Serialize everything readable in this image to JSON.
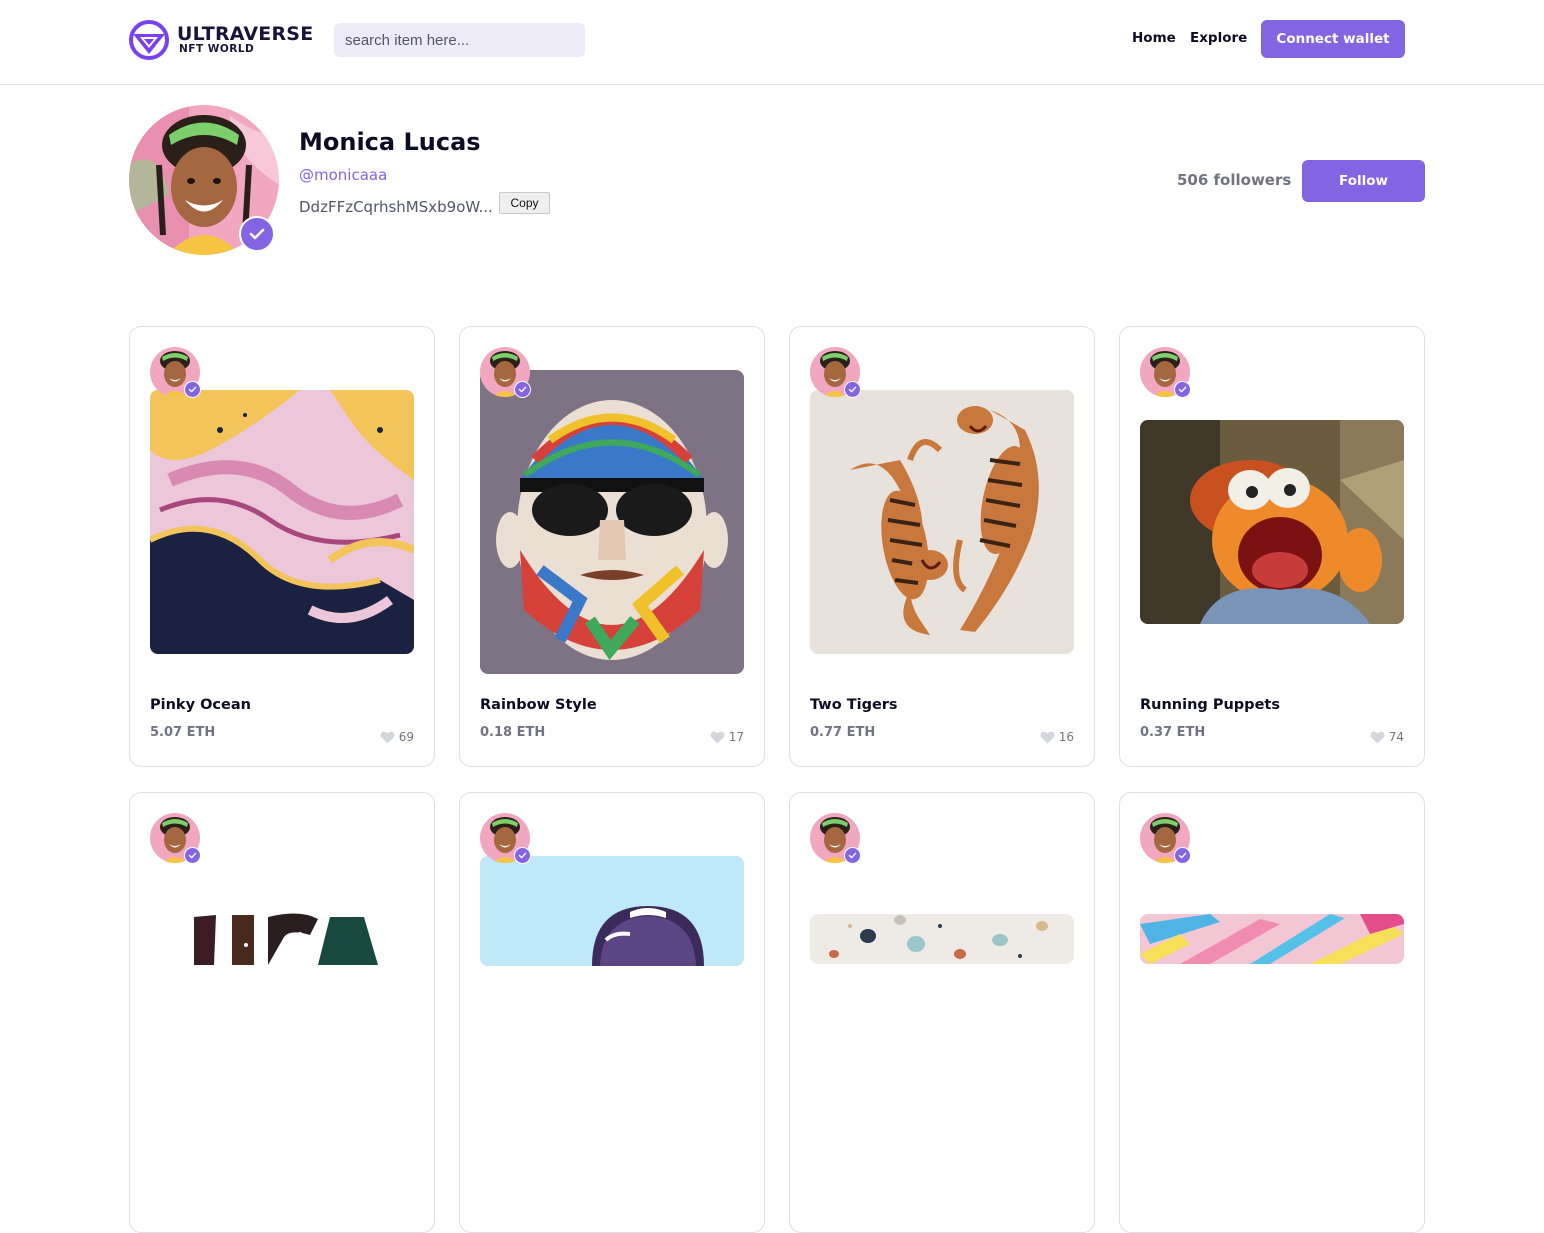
{
  "header": {
    "logo_title": "ULTRAVERSE",
    "logo_subtitle": "NFT WORLD",
    "search_placeholder": "search item here...",
    "nav": [
      {
        "label": "Home"
      },
      {
        "label": "Explore"
      }
    ],
    "connect_label": "Connect wallet"
  },
  "profile": {
    "name": "Monica Lucas",
    "handle": "@monicaaa",
    "wallet": "DdzFFzCqrhshMSxb9oW...",
    "copy_label": "Copy",
    "followers": "506 followers",
    "follow_label": "Follow"
  },
  "items": [
    {
      "title": "Pinky Ocean",
      "price": "5.07 ETH",
      "likes": "69",
      "image": "marble-pink-yellow"
    },
    {
      "title": "Rainbow Style",
      "price": "0.18 ETH",
      "likes": "17",
      "image": "mosaic-beard-man"
    },
    {
      "title": "Two Tigers",
      "price": "0.77 ETH",
      "likes": "16",
      "image": "two-tigers"
    },
    {
      "title": "Running Puppets",
      "price": "0.37 ETH",
      "likes": "74",
      "image": "running-puppet"
    },
    {
      "title": "",
      "price": "",
      "likes": "",
      "image": "usa-letters"
    },
    {
      "title": "",
      "price": "",
      "likes": "",
      "image": "astronaut-helmet"
    },
    {
      "title": "",
      "price": "",
      "likes": "",
      "image": "terrazzo"
    },
    {
      "title": "",
      "price": "",
      "likes": "",
      "image": "brush-strokes"
    }
  ],
  "colors": {
    "accent": "#8364e2",
    "text": "#0d0c22",
    "muted": "#727282",
    "search_bg": "#eeebf9"
  }
}
